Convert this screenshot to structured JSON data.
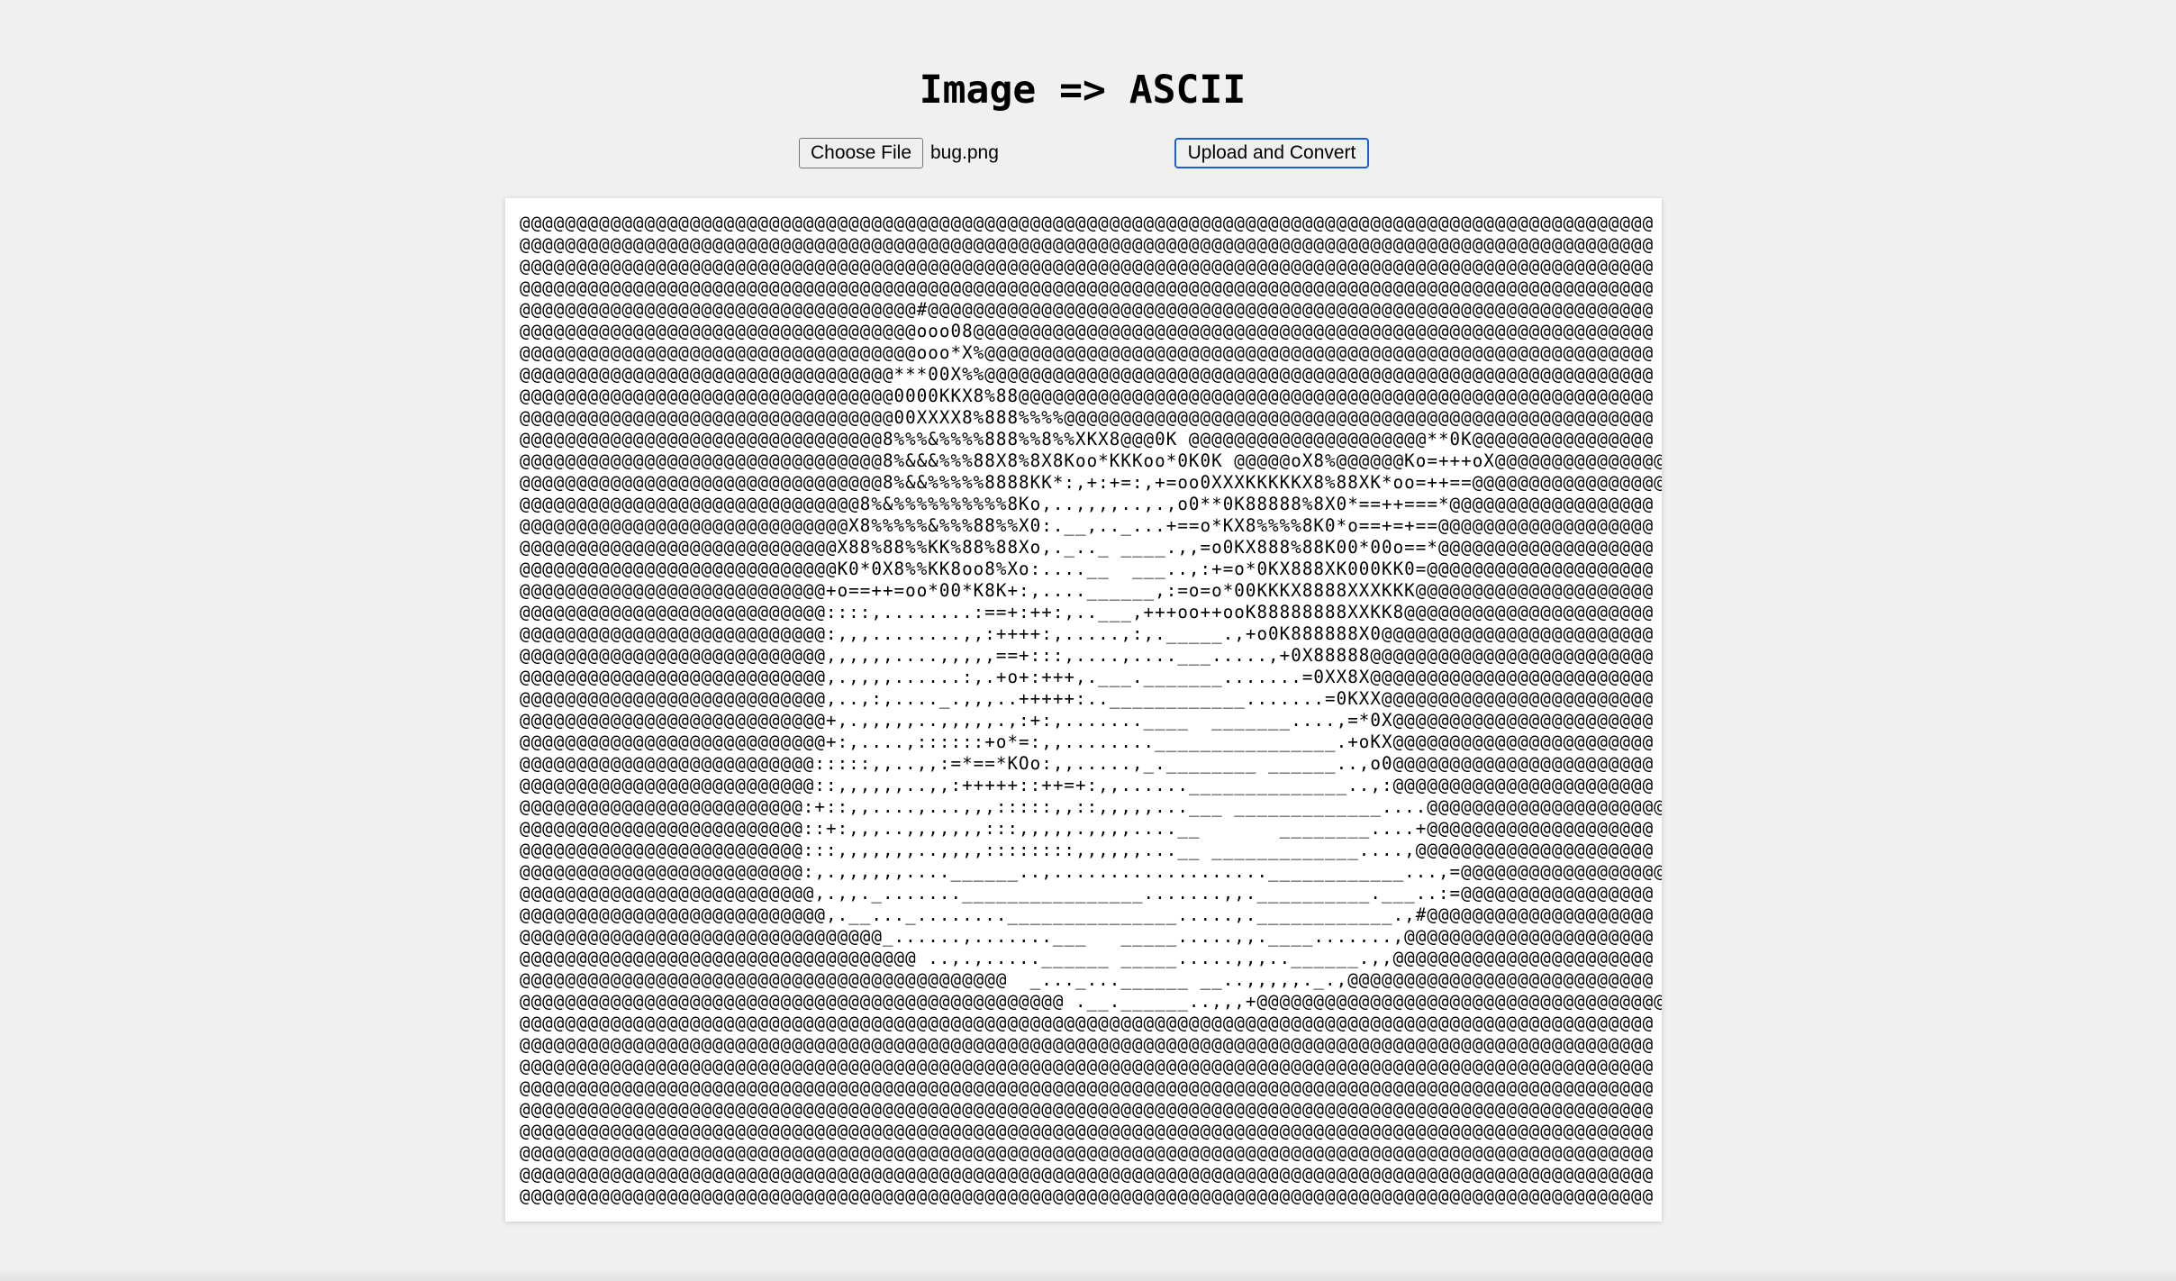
{
  "page": {
    "title": "Image => ASCII"
  },
  "form": {
    "choose_file_label": "Choose File",
    "file_name": "bug.png",
    "upload_label": "Upload and Convert"
  },
  "colors": {
    "background": "#f0f0f0",
    "panel": "#ffffff",
    "upload_button_border": "#1a5fd8"
  },
  "ascii": {
    "lines": [
      "@@@@@@@@@@@@@@@@@@@@@@@@@@@@@@@@@@@@@@@@@@@@@@@@@@@@@@@@@@@@@@@@@@@@@@@@@@@@@@@@@@@@@@@@@@@@@@@@@@@@",
      "@@@@@@@@@@@@@@@@@@@@@@@@@@@@@@@@@@@@@@@@@@@@@@@@@@@@@@@@@@@@@@@@@@@@@@@@@@@@@@@@@@@@@@@@@@@@@@@@@@@@",
      "@@@@@@@@@@@@@@@@@@@@@@@@@@@@@@@@@@@@@@@@@@@@@@@@@@@@@@@@@@@@@@@@@@@@@@@@@@@@@@@@@@@@@@@@@@@@@@@@@@@@",
      "@@@@@@@@@@@@@@@@@@@@@@@@@@@@@@@@@@@@@@@@@@@@@@@@@@@@@@@@@@@@@@@@@@@@@@@@@@@@@@@@@@@@@@@@@@@@@@@@@@@@",
      "@@@@@@@@@@@@@@@@@@@@@@@@@@@@@@@@@@@#@@@@@@@@@@@@@@@@@@@@@@@@@@@@@@@@@@@@@@@@@@@@@@@@@@@@@@@@@@@@@@@@",
      "@@@@@@@@@@@@@@@@@@@@@@@@@@@@@@@@@@@ooo08@@@@@@@@@@@@@@@@@@@@@@@@@@@@@@@@@@@@@@@@@@@@@@@@@@@@@@@@@@@@",
      "@@@@@@@@@@@@@@@@@@@@@@@@@@@@@@@@@@@ooo*X%@@@@@@@@@@@@@@@@@@@@@@@@@@@@@@@@@@@@@@@@@@@@@@@@@@@@@@@@@@@",
      "@@@@@@@@@@@@@@@@@@@@@@@@@@@@@@@@@***00X%%@@@@@@@@@@@@@@@@@@@@@@@@@@@@@@@@@@@@@@@@@@@@@@@@@@@@@@@@@@@",
      "@@@@@@@@@@@@@@@@@@@@@@@@@@@@@@@@@0000KKX8%88@@@@@@@@@@@@@@@@@@@@@@@@@@@@@@@@@@@@@@@@@@@@@@@@@@@@@@@@",
      "@@@@@@@@@@@@@@@@@@@@@@@@@@@@@@@@@00XXXX8%888%%%%@@@@@@@@@@@@@@@@@@@@@@@@@@@@@@@@@@@@@@@@@@@@@@@@@@@@",
      "@@@@@@@@@@@@@@@@@@@@@@@@@@@@@@@@8%%%&%%%%888%%8%%XKX8@@@0K @@@@@@@@@@@@@@@@@@@@@**0K@@@@@@@@@@@@@@@@",
      "@@@@@@@@@@@@@@@@@@@@@@@@@@@@@@@@8%&&&%%%88X8%8X8Koo*KKKoo*0K0K @@@@@oX8%@@@@@@Ko=+++oX@@@@@@@@@@@@@@@",
      "@@@@@@@@@@@@@@@@@@@@@@@@@@@@@@@@8%&&%%%%%8888KK*:,+:+=:,+=oo0XXXKKKKKX8%88XK*oo=++==@@@@@@@@@@@@@@@@@",
      "@@@@@@@@@@@@@@@@@@@@@@@@@@@@@@8%&%%%%%%%%%%8Ko,..,,,,..,.,o0**0K88888%8X0*==++===*@@@@@@@@@@@@@@@@@@",
      "@@@@@@@@@@@@@@@@@@@@@@@@@@@@@X8%%%%%&%%%88%%X0:.__,.._...+==o*KX8%%%%8K0*o==+=+==@@@@@@@@@@@@@@@@@@@",
      "@@@@@@@@@@@@@@@@@@@@@@@@@@@@X88%88%%KK%88%88Xo,._.._ ____.,,=o0KX888%88K00*00o==*@@@@@@@@@@@@@@@@@@@",
      "@@@@@@@@@@@@@@@@@@@@@@@@@@@@K0*0X8%%KK8oo8%Xo:....__  ___..,:+=o*0KX888XK000KK0=@@@@@@@@@@@@@@@@@@@@",
      "@@@@@@@@@@@@@@@@@@@@@@@@@@@+o==++=oo*00*K8K+:,....______,:=o=o*00KKKX8888XXXKKK@@@@@@@@@@@@@@@@@@@@@",
      "@@@@@@@@@@@@@@@@@@@@@@@@@@@::::,........:==+:++:,..___,+++oo++ooK88888888XXKK8@@@@@@@@@@@@@@@@@@@@@@",
      "@@@@@@@@@@@@@@@@@@@@@@@@@@@:,,,........,,:++++:,.....,:,._____.,+o0K888888X0@@@@@@@@@@@@@@@@@@@@@@@@",
      "@@@@@@@@@@@@@@@@@@@@@@@@@@@,,,,,,....,,,,,==+:::,....,....___.....,+0X88888@@@@@@@@@@@@@@@@@@@@@@@@@",
      "@@@@@@@@@@@@@@@@@@@@@@@@@@@,.,,,,......:,.+o+:+++,.___._______.......=0XX8X@@@@@@@@@@@@@@@@@@@@@@@@@",
      "@@@@@@@@@@@@@@@@@@@@@@@@@@@,..,:,...._.,,,..+++++:..____________.......=0KXX@@@@@@@@@@@@@@@@@@@@@@@@",
      "@@@@@@@@@@@@@@@@@@@@@@@@@@@+,.,,,,,..,,,,,.,:+:,.......____  _______....,=*0X@@@@@@@@@@@@@@@@@@@@@@@",
      "@@@@@@@@@@@@@@@@@@@@@@@@@@@+:,....,::::::+o*=:,,........________________.+oKX@@@@@@@@@@@@@@@@@@@@@@@",
      "@@@@@@@@@@@@@@@@@@@@@@@@@@:::::,,..,,:=*==*KOo:,,.....,_.________ ______..,o0@@@@@@@@@@@@@@@@@@@@@@@",
      "@@@@@@@@@@@@@@@@@@@@@@@@@@::,,,,,,..,,:+++++::++=+:,,......______________..,:@@@@@@@@@@@@@@@@@@@@@@@",
      "@@@@@@@@@@@@@@@@@@@@@@@@@:+::,,....,...,,,:::::,,::,,,,,...___ _____________....@@@@@@@@@@@@@@@@@@@@@",
      "@@@@@@@@@@@@@@@@@@@@@@@@@::+:,,,..,,,,,,,:::,,,,,.,,,,....__       ________....+@@@@@@@@@@@@@@@@@@@@",
      "@@@@@@@@@@@@@@@@@@@@@@@@@:::,,,,,,,..,,,,::::::::,,,,,,...__ _____________....,@@@@@@@@@@@@@@@@@@@@@",
      "@@@@@@@@@@@@@@@@@@@@@@@@@:,.,,,,,,....______..,...................____________...,=@@@@@@@@@@@@@@@@@@",
      "@@@@@@@@@@@@@@@@@@@@@@@@@@,.,,._.......________________.......,,.__________.___..:=@@@@@@@@@@@@@@@@@",
      "@@@@@@@@@@@@@@@@@@@@@@@@@@@,.__..._........_______________.....,.____________.,#@@@@@@@@@@@@@@@@@@@@",
      "@@@@@@@@@@@@@@@@@@@@@@@@@@@@@@@@_......,.......___   _____.....,,.____.......,@@@@@@@@@@@@@@@@@@@@@@",
      "@@@@@@@@@@@@@@@@@@@@@@@@@@@@@@@@@@@ ..,.,.....______ _____.....,,,..______.,,@@@@@@@@@@@@@@@@@@@@@@@",
      "@@@@@@@@@@@@@@@@@@@@@@@@@@@@@@@@@@@@@@@@@@@  _..._...______ __..,,,,,._.,@@@@@@@@@@@@@@@@@@@@@@@@@@@",
      "@@@@@@@@@@@@@@@@@@@@@@@@@@@@@@@@@@@@@@@@@@@@@@@@ .__.______..,,,+@@@@@@@@@@@@@@@@@@@@@@@@@@@@@@@@@@@@",
      "@@@@@@@@@@@@@@@@@@@@@@@@@@@@@@@@@@@@@@@@@@@@@@@@@@@@@@@@@@@@@@@@@@@@@@@@@@@@@@@@@@@@@@@@@@@@@@@@@@@@",
      "@@@@@@@@@@@@@@@@@@@@@@@@@@@@@@@@@@@@@@@@@@@@@@@@@@@@@@@@@@@@@@@@@@@@@@@@@@@@@@@@@@@@@@@@@@@@@@@@@@@@",
      "@@@@@@@@@@@@@@@@@@@@@@@@@@@@@@@@@@@@@@@@@@@@@@@@@@@@@@@@@@@@@@@@@@@@@@@@@@@@@@@@@@@@@@@@@@@@@@@@@@@@",
      "@@@@@@@@@@@@@@@@@@@@@@@@@@@@@@@@@@@@@@@@@@@@@@@@@@@@@@@@@@@@@@@@@@@@@@@@@@@@@@@@@@@@@@@@@@@@@@@@@@@@",
      "@@@@@@@@@@@@@@@@@@@@@@@@@@@@@@@@@@@@@@@@@@@@@@@@@@@@@@@@@@@@@@@@@@@@@@@@@@@@@@@@@@@@@@@@@@@@@@@@@@@@",
      "@@@@@@@@@@@@@@@@@@@@@@@@@@@@@@@@@@@@@@@@@@@@@@@@@@@@@@@@@@@@@@@@@@@@@@@@@@@@@@@@@@@@@@@@@@@@@@@@@@@@",
      "@@@@@@@@@@@@@@@@@@@@@@@@@@@@@@@@@@@@@@@@@@@@@@@@@@@@@@@@@@@@@@@@@@@@@@@@@@@@@@@@@@@@@@@@@@@@@@@@@@@@",
      "@@@@@@@@@@@@@@@@@@@@@@@@@@@@@@@@@@@@@@@@@@@@@@@@@@@@@@@@@@@@@@@@@@@@@@@@@@@@@@@@@@@@@@@@@@@@@@@@@@@@",
      "@@@@@@@@@@@@@@@@@@@@@@@@@@@@@@@@@@@@@@@@@@@@@@@@@@@@@@@@@@@@@@@@@@@@@@@@@@@@@@@@@@@@@@@@@@@@@@@@@@@@"
    ]
  }
}
